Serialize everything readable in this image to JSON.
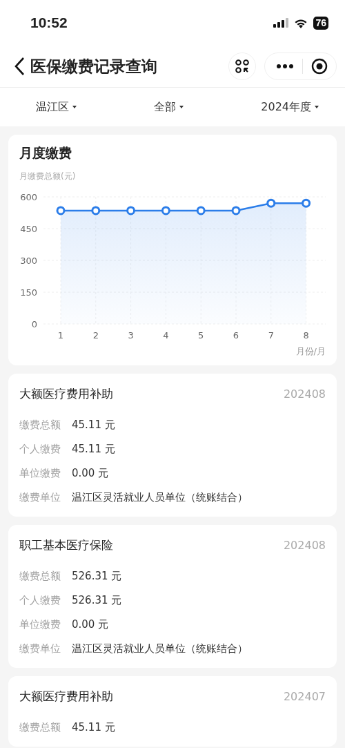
{
  "status_bar": {
    "time": "10:52",
    "battery": "76"
  },
  "nav": {
    "title": "医保缴费记录查询"
  },
  "filters": [
    {
      "label": "温江区"
    },
    {
      "label": "全部"
    },
    {
      "label": "2024年度"
    }
  ],
  "chart_card": {
    "title": "月度缴费",
    "chart_data": {
      "type": "area",
      "ylabel": "月缴费总额(元)",
      "xlabel": "月份/月",
      "x": [
        "1",
        "2",
        "3",
        "4",
        "5",
        "6",
        "7",
        "8"
      ],
      "series": [
        {
          "color": "#2b7de9",
          "values": [
            535,
            535,
            535,
            535,
            535,
            535,
            570,
            570
          ]
        }
      ],
      "grid": true,
      "ylim": [
        0,
        600
      ],
      "yticks": [
        0,
        150,
        300,
        450,
        600
      ]
    }
  },
  "records": [
    {
      "title": "大额医疗费用补助",
      "period": "202408",
      "fields": [
        {
          "label": "缴费总额",
          "value": "45.11 元"
        },
        {
          "label": "个人缴费",
          "value": "45.11 元"
        },
        {
          "label": "单位缴费",
          "value": "0.00 元"
        },
        {
          "label": "缴费单位",
          "value": "温江区灵活就业人员单位（统账结合）"
        }
      ]
    },
    {
      "title": "职工基本医疗保险",
      "period": "202408",
      "fields": [
        {
          "label": "缴费总额",
          "value": "526.31 元"
        },
        {
          "label": "个人缴费",
          "value": "526.31 元"
        },
        {
          "label": "单位缴费",
          "value": "0.00 元"
        },
        {
          "label": "缴费单位",
          "value": "温江区灵活就业人员单位（统账结合）"
        }
      ]
    },
    {
      "title": "大额医疗费用补助",
      "period": "202407",
      "fields": [
        {
          "label": "缴费总额",
          "value": "45.11 元"
        }
      ]
    }
  ]
}
